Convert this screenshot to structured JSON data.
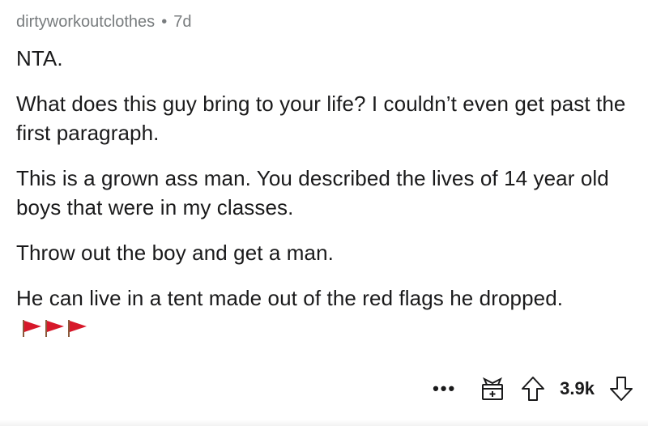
{
  "comment": {
    "author": "dirtyworkoutclothes",
    "separator": "•",
    "age": "7d",
    "paragraphs": [
      "NTA.",
      "What does this guy bring to your life?  I couldn’t even get past the first paragraph.",
      "This is a grown ass man. You described the lives of 14 year old boys that were in my classes.",
      "Throw out the boy and get a man.",
      "He can live in a tent made out of the red flags he dropped."
    ],
    "emoji": "red-flag-icon ×3",
    "actions": {
      "more": "•••",
      "award_icon": "gift-icon",
      "upvote_icon": "upvote-arrow-icon",
      "score": "3.9k",
      "downvote_icon": "downvote-arrow-icon"
    }
  },
  "colors": {
    "meta_text": "#787c7e",
    "body_text": "#1a1a1b",
    "flag_red": "#d7182a",
    "flag_pole": "#8a5a3c"
  }
}
